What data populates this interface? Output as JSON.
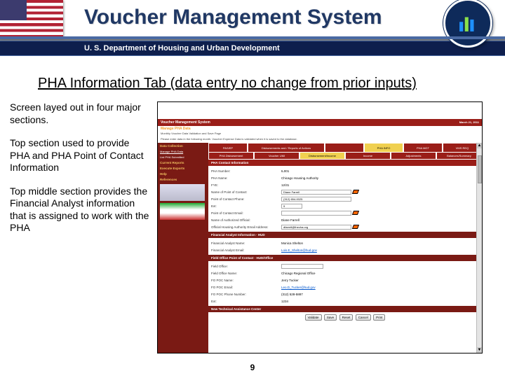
{
  "slide": {
    "title": "Voucher Management System",
    "hud_bar": "U. S. Department of Housing and Urban Development",
    "subtitle": "PHA Information Tab (data entry no change from prior inputs)",
    "page_number": "9"
  },
  "notes": {
    "p1": "Screen layed out in four major sections.",
    "p2": "Top section used to provide PHA and PHA Point of Contact Information",
    "p3": "Top middle section provides the Financial Analyst information that is assigned to work with the PHA"
  },
  "embed": {
    "app_title": "Voucher Management System",
    "page_heading": "Manage PHA Data",
    "date": "March 21, 2011",
    "subheading": "Monthly Voucher Data Validation and Save Page",
    "instruction": "Please enter data in the following month. Voucher Expense Data is validated when it is saved to the database.",
    "sidebar": {
      "group1": "Data Collection",
      "item1": "Manage PHA Data",
      "item2": "List PHA Submitted",
      "group2": "Current Reports",
      "group3": "Execute Exports",
      "group4": "Help",
      "group5": "References"
    },
    "tabs_row1": [
      "PAS/EP",
      "Disbursements and / Reports of Actions",
      "",
      "PHA INFO",
      "PHA MGT",
      "VMS REQ"
    ],
    "tabs_row2": [
      "PHA Disbursement",
      "Voucher UMI",
      "Disbursement/Income",
      "Income",
      "Adjustments",
      "Balances/Summary"
    ],
    "sec_contact": "PHA Contact Information",
    "rows_contact": [
      {
        "label": "PHA Number:",
        "value": "IL001"
      },
      {
        "label": "PHA Name:",
        "value": "Chicago Housing Authority"
      },
      {
        "label": "FYE:",
        "value": "12/31"
      },
      {
        "label": "Name of Point of Contact:",
        "value": "Diane Farrell"
      },
      {
        "label": "Point of Contact Phone:",
        "value": "(312) 654-0025"
      },
      {
        "label": "Ext:",
        "value": "9"
      },
      {
        "label": "Point of Contact Email:",
        "value": ""
      },
      {
        "label": "Name of Authorized Official:",
        "value": "Diane Farrell"
      },
      {
        "label": "Official Housing Authority Email Address:",
        "value": "dfarrell@thecha.org"
      }
    ],
    "sec_fa": "Financial Analyst Information · HUD",
    "rows_fa": [
      {
        "label": "Financial Analyst Name:",
        "value": "Monica Shelton"
      },
      {
        "label": "Financial Analyst Email:",
        "value": "Lois.E_Shelton@hud.gov"
      }
    ],
    "sec_fo": "Field Office Point of Contact · HUD/Office",
    "rows_fo": [
      {
        "label": "Field Office:",
        "value": ""
      },
      {
        "label": "Field Office Name:",
        "value": "Chicago Regional Office"
      },
      {
        "label": "FO POC Name:",
        "value": "Jerry Tucker"
      },
      {
        "label": "FO POC Email:",
        "value": "Leo.D_Tucker@hud.gov"
      },
      {
        "label": "FO POC Phone Number:",
        "value": "(312) 528-5887"
      },
      {
        "label": "Ext:",
        "value": "1234"
      }
    ],
    "sec_tech": "New Technical Assistance Center",
    "buttons": [
      "Validate",
      "Save",
      "Reset",
      "Cancel",
      "Print"
    ]
  }
}
